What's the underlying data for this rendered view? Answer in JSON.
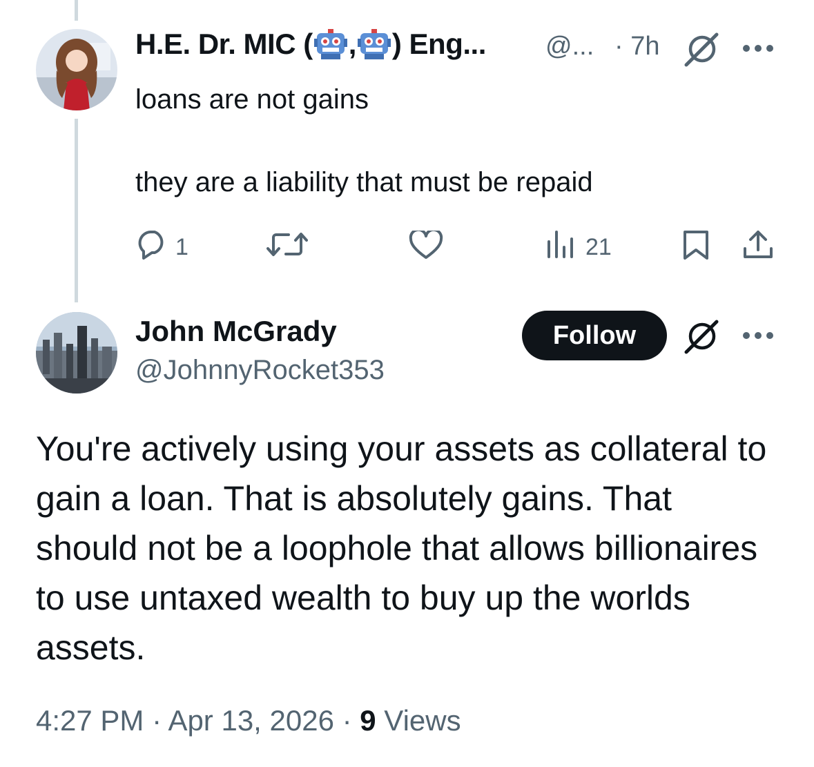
{
  "parent_tweet": {
    "display_name_prefix": "H.E. Dr. MIC (",
    "display_name_sep": ",",
    "display_name_suffix": ") Eng...",
    "handle": "@...",
    "time": "· 7h",
    "text_line1": "loans are not gains",
    "text_line2": "they are a liability that must be repaid",
    "reply_count": "1",
    "views_count": "21",
    "icons": [
      "grok-icon",
      "more-icon",
      "reply-icon",
      "retweet-icon",
      "like-icon",
      "views-icon",
      "bookmark-icon",
      "share-icon"
    ]
  },
  "main_tweet": {
    "display_name": "John McGrady",
    "handle": "@JohnnyRocket353",
    "follow_label": "Follow",
    "text": "You're actively using your assets as collateral to gain a loan. That is absolutely gains. That should not be a loophole that allows billionaires to use untaxed wealth to buy up the worlds assets.",
    "time": "4:27 PM",
    "sep1": " · ",
    "date": "Apr 13, 2026",
    "sep2": " · ",
    "views_count": "9",
    "views_label": " Views",
    "icons": [
      "grok-icon",
      "more-icon"
    ]
  },
  "colors": {
    "text": "#0f1419",
    "secondary": "#536471",
    "thread_line": "#cfd9de",
    "follow_bg": "#0f1419",
    "robot_blue": "#5b8fd6"
  }
}
